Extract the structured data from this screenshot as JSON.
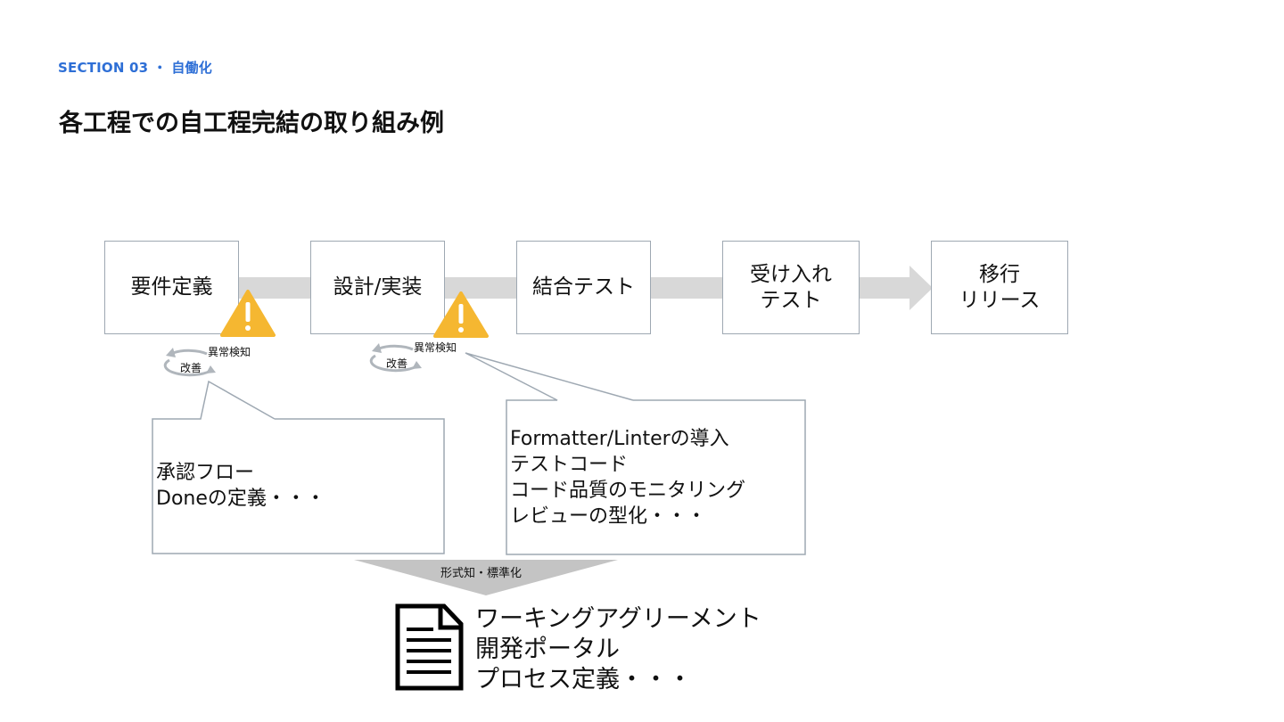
{
  "header": {
    "section": "SECTION 03 ・ 自働化",
    "title": "各工程での自工程完結の取り組み例"
  },
  "steps": [
    {
      "label": "要件定義"
    },
    {
      "label": "設計/実装"
    },
    {
      "label": "結合テスト"
    },
    {
      "label": "受け入れ\nテスト"
    },
    {
      "label": "移行\nリリース"
    }
  ],
  "loops": [
    {
      "detect": "異常検知",
      "improve": "改善"
    },
    {
      "detect": "異常検知",
      "improve": "改善"
    }
  ],
  "callouts": [
    {
      "text": "承認フロー\nDoneの定義・・・"
    },
    {
      "text": "Formatter/Linterの導入\nテストコード\nコード品質のモニタリング\nレビューの型化・・・"
    }
  ],
  "funnel_label": "形式知・標準化",
  "artifact": {
    "icon": "document-icon",
    "text": "ワーキングアグリーメント\n開発ポータル\nプロセス定義・・・"
  },
  "colors": {
    "accent": "#2e6fd6",
    "warning": "#f5b731",
    "arrow": "#d8d8d8",
    "border": "#9ea8b2"
  }
}
